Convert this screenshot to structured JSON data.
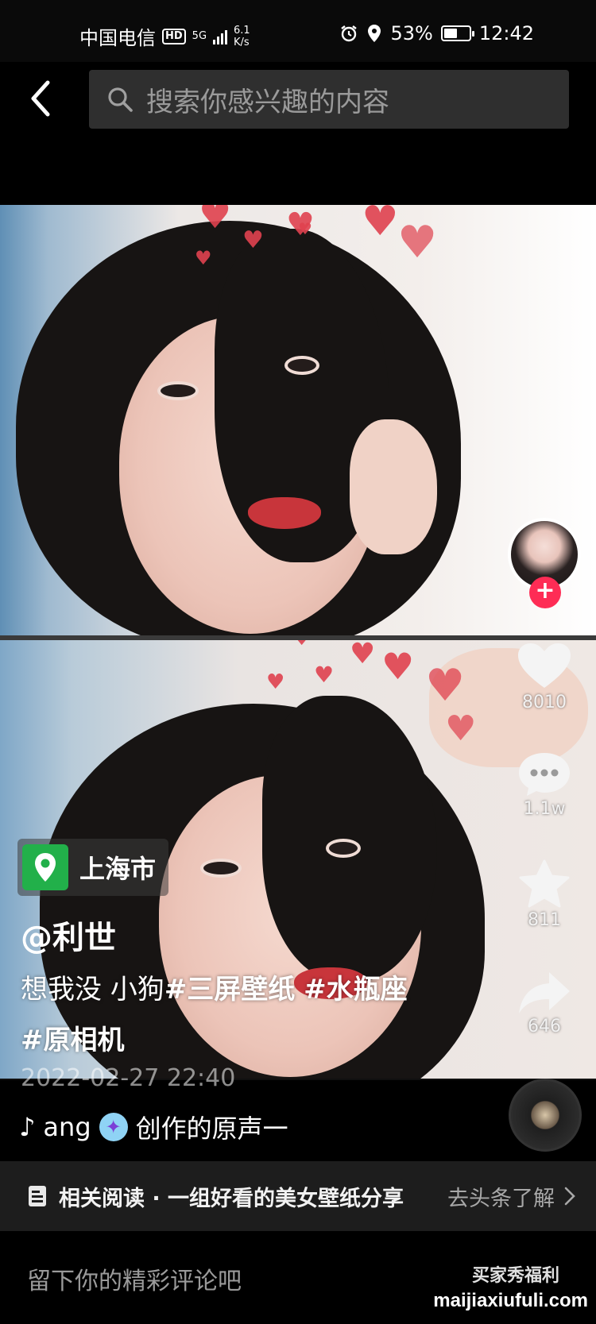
{
  "status_bar": {
    "carrier": "中国电信",
    "hd": "HD",
    "network": "5G",
    "speed_value": "6.1",
    "speed_unit": "K/s",
    "battery_percent": "53%",
    "battery_level": 0.53,
    "time": "12:42"
  },
  "search": {
    "placeholder": "搜索你感兴趣的内容"
  },
  "icons": {
    "back": "back-arrow-icon",
    "search": "search-icon",
    "like": "heart-icon",
    "comment": "comment-icon",
    "favorite": "star-icon",
    "share": "share-icon",
    "location": "location-pin-icon",
    "music": "music-note-icon",
    "related": "document-icon",
    "chevron": "chevron-right-icon"
  },
  "actions": {
    "follow_label": "+",
    "likes": "8010",
    "comments": "1.1w",
    "favorites": "811",
    "shares": "646"
  },
  "post": {
    "location": "上海市",
    "author": "@利世",
    "caption_text": "想我没  小狗",
    "tag_1": "#三屏壁纸",
    "tag_2": "#水瓶座",
    "tag_3": "#原相机",
    "datetime": "2022-02-27 22:40"
  },
  "music": {
    "text_prefix": "ang",
    "text_suffix": "创作的原声一"
  },
  "related": {
    "text": "相关阅读 · 一组好看的美女壁纸分享",
    "link": "去头条了解"
  },
  "comment": {
    "placeholder": "留下你的精彩评论吧"
  },
  "watermark": {
    "name": "买家秀福利",
    "url": "maijiaxiufuli.com"
  },
  "colors": {
    "background": "#000000",
    "search_bg": "#2f2f2f",
    "follow_red": "#fe2c55",
    "location_green": "#22b04a",
    "related_bg": "#1d1d1d"
  }
}
